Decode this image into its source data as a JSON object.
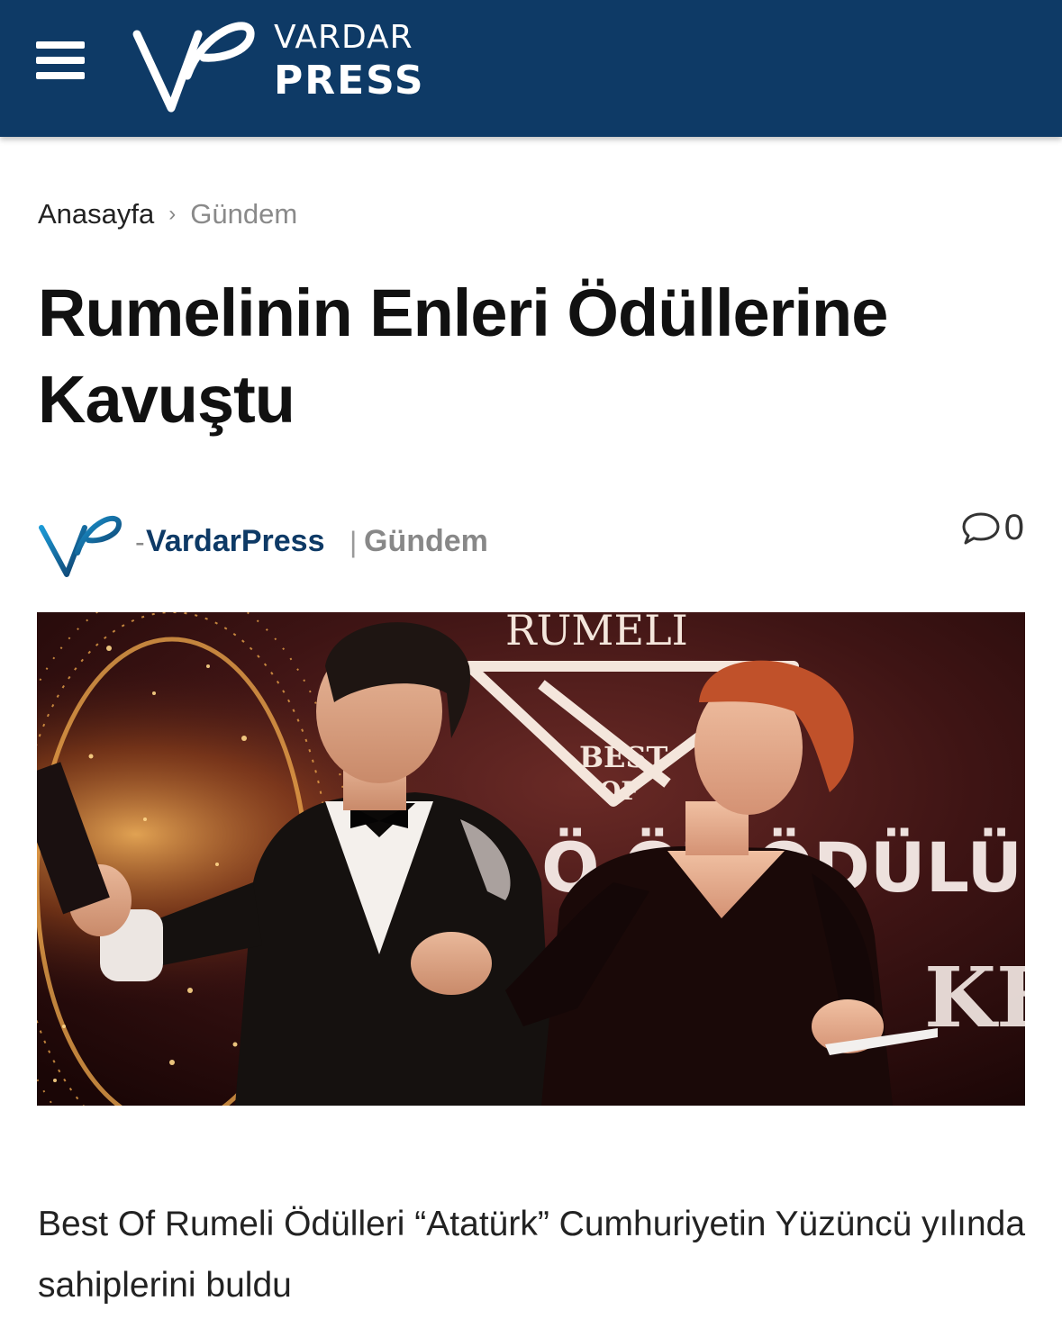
{
  "header": {
    "brand_line1": "VARDAR",
    "brand_line2": "PRESS",
    "menu_icon": "hamburger-icon",
    "logo_icon": "vp-logo-icon",
    "background_color": "#0e3a66"
  },
  "breadcrumb": {
    "home": "Anasayfa",
    "separator": "›",
    "current": "Gündem"
  },
  "article": {
    "title": "Rumelinin Enleri Ödüllerine Kavuştu",
    "author_prefix": "-",
    "author": "VardarPress",
    "category_separator": "|",
    "category": "Gündem",
    "comment_count": "0",
    "comment_icon": "comment-bubble-icon",
    "lead": "Best Of Rumeli Ödülleri “Atatürk” Cumhuriyetin Yüzüncü yılında sahiplerini buldu"
  },
  "hero_image": {
    "stage_text_top": "RUMELI",
    "stage_text_best": "BEST",
    "stage_text_of": "OF",
    "stage_text_award": "Ö ÖZ ÖDÜLÜ",
    "stage_text_right": "KEF"
  }
}
